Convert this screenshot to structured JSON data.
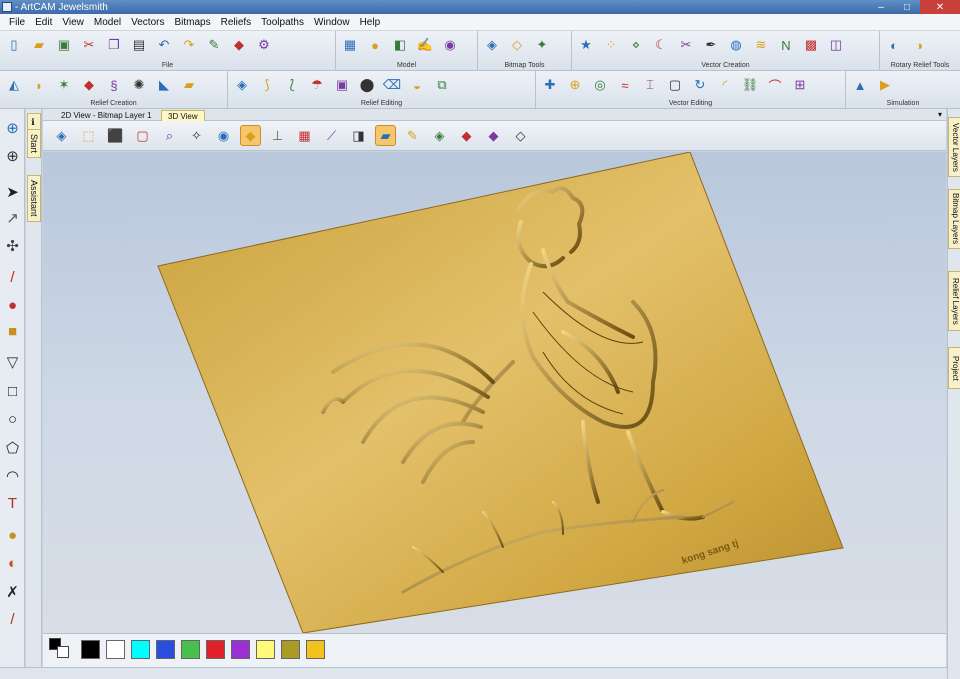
{
  "window": {
    "title": "- ArtCAM Jewelsmith"
  },
  "menu": [
    "File",
    "Edit",
    "View",
    "Model",
    "Vectors",
    "Bitmaps",
    "Reliefs",
    "Toolpaths",
    "Window",
    "Help"
  ],
  "toolbar_groups_row1": [
    {
      "label": "File",
      "icons": [
        "new-file-icon",
        "open-folder-icon",
        "save-icon",
        "cut-icon",
        "copy-icon",
        "paste-icon",
        "undo-icon",
        "redo-icon",
        "edit-icon",
        "book-icon",
        "tool-icon"
      ]
    },
    {
      "label": "Model",
      "icons": [
        "model-icon",
        "bear-icon",
        "grayscale-icon",
        "paint-icon",
        "sphere-icon"
      ]
    },
    {
      "label": "Bitmap Tools",
      "icons": [
        "bitmap-a-icon",
        "bitmap-b-icon",
        "bitmap-c-icon"
      ]
    },
    {
      "label": "Vector Creation",
      "icons": [
        "star-icon",
        "points-icon",
        "node-icon",
        "crescent-icon",
        "scissors-icon",
        "pen-icon",
        "ring-icon",
        "stack-icon",
        "nesting-icon",
        "matrix-icon",
        "layers-icon"
      ]
    },
    {
      "label": "Rotary Relief Tools",
      "icons": [
        "rotary-a-icon",
        "rotary-b-icon"
      ]
    }
  ],
  "toolbar_groups_row2": [
    {
      "label": "Relief Creation",
      "icons": [
        "shape-icon",
        "sweep-icon",
        "star-relief-icon",
        "extrude-icon",
        "spiral-icon",
        "weave-icon",
        "slice-icon",
        "flat-icon"
      ]
    },
    {
      "label": "Relief Editing",
      "icons": [
        "smooth-icon",
        "sculpt-a-icon",
        "sculpt-b-icon",
        "sculpt-c-icon",
        "texture-icon",
        "stamp-icon",
        "erase-icon",
        "blend-icon",
        "offset-icon"
      ]
    },
    {
      "label": "Vector Editing",
      "icons": [
        "add-icon",
        "weld-icon",
        "trim-icon",
        "wave-icon",
        "align-icon",
        "group-icon",
        "loop-icon",
        "fillet-icon",
        "chain-icon",
        "bend-icon",
        "transform-icon"
      ]
    },
    {
      "label": "Simulation",
      "icons": [
        "sim-a-icon",
        "sim-b-icon"
      ]
    }
  ],
  "tabs": {
    "bitmap": "2D View - Bitmap Layer 1",
    "view3d": "3D View"
  },
  "left_panel": {
    "start": "Start",
    "assistant": "Assistant"
  },
  "right_panel": [
    "Vector Layers",
    "Bitmap Layers",
    "Relief Layers",
    "Project"
  ],
  "view_tools": [
    "iso-view-icon",
    "wire-box-icon",
    "side-box-icon",
    "front-box-icon",
    "zoom-icon",
    "light-icon",
    "eye-icon",
    "relief-shade-icon",
    "axes-icon",
    "material-icon",
    "blade-icon",
    "layer-icon",
    "plate-icon",
    "brush-icon",
    "toolpath-icon",
    "solid-icon",
    "red-icon",
    "mesh-icon"
  ],
  "relief": {
    "signature": "kong sang tj"
  },
  "palette": [
    "#000000",
    "#ffffff",
    "#00ffff",
    "#2a4fe0",
    "#49c04c",
    "#e0202a",
    "#9a2fd6",
    "#fffa7a",
    "#a99b24",
    "#f4c21c"
  ],
  "colors": {
    "gold": "#d4a838",
    "gold_dark": "#7a5a12",
    "viewport_sky": "#b9c7dc"
  }
}
